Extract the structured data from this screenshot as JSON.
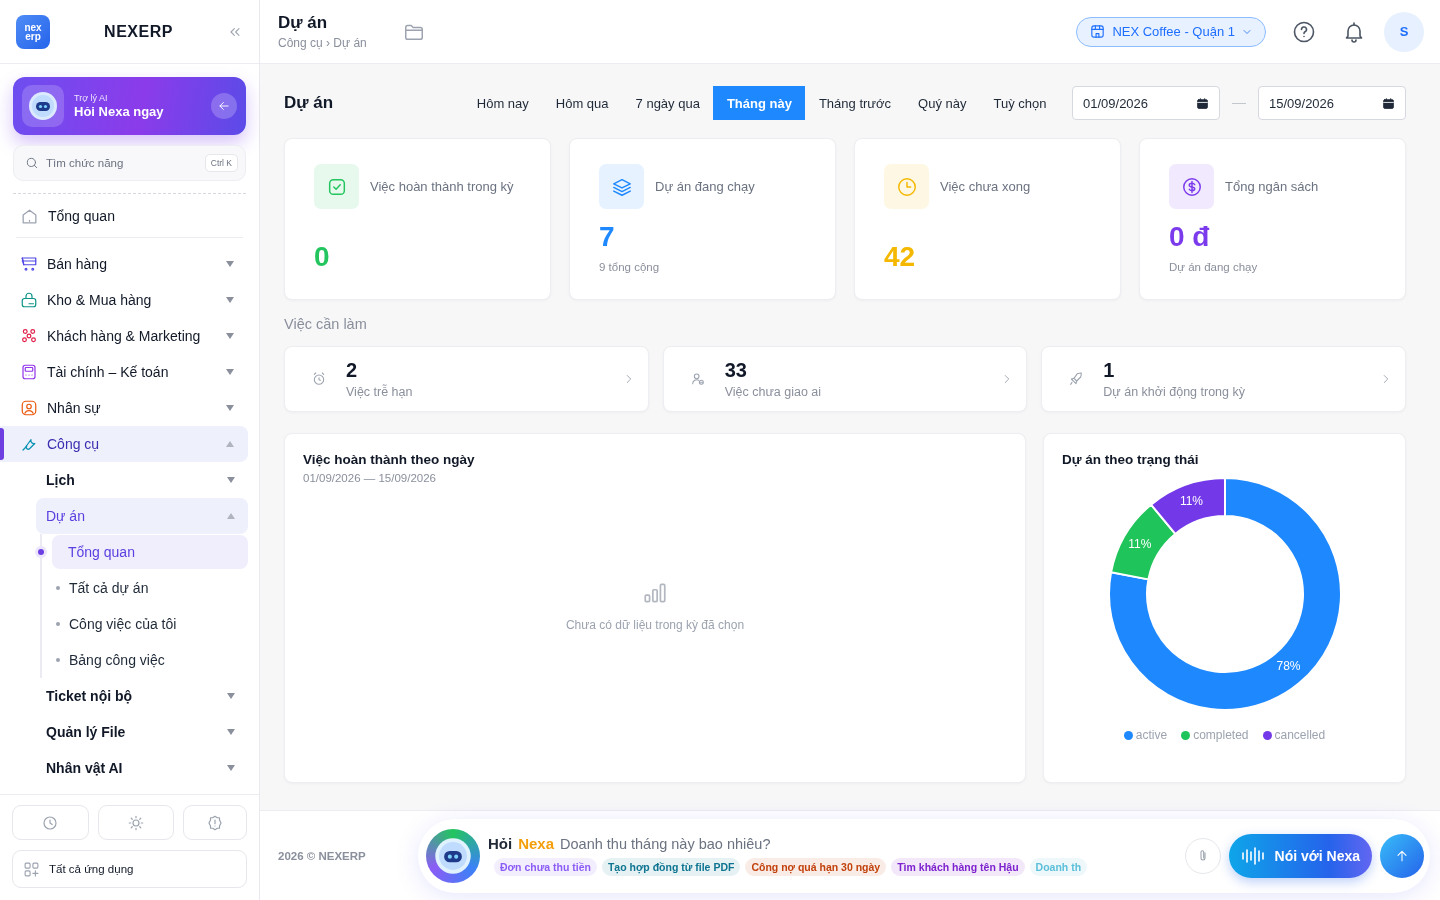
{
  "sidebar": {
    "logo": [
      "nex",
      "erp"
    ],
    "brand": "NEXERP",
    "assistant": {
      "caption": "Trợ lý AI",
      "title": "Hỏi Nexa ngay"
    },
    "search": {
      "placeholder": "Tìm chức năng",
      "shortcut": "Ctrl K"
    },
    "overview": {
      "label": "Tổng quan",
      "selected": false
    },
    "modules": [
      {
        "label": "Bán hàng",
        "expanded": false,
        "selected": false
      },
      {
        "label": "Kho & Mua hàng",
        "expanded": false,
        "selected": false
      },
      {
        "label": "Khách hàng & Marketing",
        "expanded": false,
        "selected": false
      },
      {
        "label": "Tài chính – Kế toán",
        "expanded": false,
        "selected": false
      },
      {
        "label": "Nhân sự",
        "expanded": false,
        "selected": false
      },
      {
        "label": "Công cụ",
        "expanded": true,
        "selected": true,
        "children": [
          {
            "label": "Lịch",
            "expanded": false,
            "selected": false
          },
          {
            "label": "Dự án",
            "expanded": true,
            "selected": true,
            "children": [
              {
                "label": "Tổng quan",
                "selected": true
              },
              {
                "label": "Tất cả dự án",
                "selected": false
              },
              {
                "label": "Công việc của tôi",
                "selected": false
              },
              {
                "label": "Bảng công việc",
                "selected": false
              }
            ]
          },
          {
            "label": "Ticket nội bộ",
            "expanded": false,
            "selected": false
          },
          {
            "label": "Quản lý File",
            "expanded": false,
            "selected": false
          },
          {
            "label": "Nhân vật AI",
            "expanded": false,
            "selected": false
          }
        ]
      }
    ],
    "all_apps": "Tất cả ứng dụng"
  },
  "header": {
    "title": "Dự án",
    "breadcrumb": "Công cụ › Dự án",
    "store": "NEX Coffee - Quận 1",
    "avatar": "S"
  },
  "page": {
    "title": "Dự án",
    "periods": [
      {
        "label": "Hôm nay",
        "selected": false
      },
      {
        "label": "Hôm qua",
        "selected": false
      },
      {
        "label": "7 ngày qua",
        "selected": false
      },
      {
        "label": "Tháng này",
        "selected": true
      },
      {
        "label": "Tháng trước",
        "selected": false
      },
      {
        "label": "Quý này",
        "selected": false
      },
      {
        "label": "Tuỳ chọn",
        "selected": false
      }
    ],
    "date_from": "01/09/2026",
    "date_to": "15/09/2026",
    "stats": [
      {
        "label": "Việc hoàn thành trong kỳ",
        "value": "0",
        "color": "#22c55e"
      },
      {
        "label": "Dự án đang chạy",
        "value": "7",
        "note": "9 tổng cộng",
        "color": "#1e88ff"
      },
      {
        "label": "Việc chưa xong",
        "value": "42",
        "color": "#f5b800"
      },
      {
        "label": "Tổng ngân sách",
        "value": "0 đ",
        "note": "Dự án đang chạy",
        "color": "#7c3aed"
      }
    ],
    "todo_title": "Việc cần làm",
    "todos": [
      {
        "value": "2",
        "label": "Việc trễ hạn"
      },
      {
        "value": "33",
        "label": "Việc chưa giao ai"
      },
      {
        "value": "1",
        "label": "Dự án khởi động trong kỳ"
      }
    ],
    "daily_chart": {
      "title": "Việc hoàn thành theo ngày",
      "range": "01/09/2026 — 15/09/2026",
      "empty": "Chưa có dữ liệu trong kỳ đã chọn"
    },
    "status_chart": {
      "chart_data": {
        "type": "donut",
        "title": "Dự án theo trạng thái",
        "categories": [
          "active",
          "completed",
          "cancelled"
        ],
        "values": [
          78,
          11,
          11
        ],
        "colors": [
          "#1e88ff",
          "#1fc45a",
          "#7339e8"
        ],
        "value_labels": [
          "78%",
          "11%",
          "11%"
        ]
      }
    }
  },
  "footer": {
    "copyright": "2026 © NEXERP",
    "assistant": {
      "title": "Hỏi",
      "brand": "Nexa",
      "placeholder": "Doanh thu tháng này bao nhiêu?",
      "chips": [
        {
          "label": "Đơn chưa thu tiền",
          "color": "#8b5cf6"
        },
        {
          "label": "Tạo hợp đồng từ file PDF",
          "color": "#0e7490"
        },
        {
          "label": "Công nợ quá hạn 30 ngày",
          "color": "#c2410c"
        },
        {
          "label": "Tìm khách hàng tên Hậu",
          "color": "#7e22ce"
        },
        {
          "label": "Doanh th",
          "color": "#5bbfd9"
        }
      ],
      "voice": "Nói với Nexa"
    }
  }
}
